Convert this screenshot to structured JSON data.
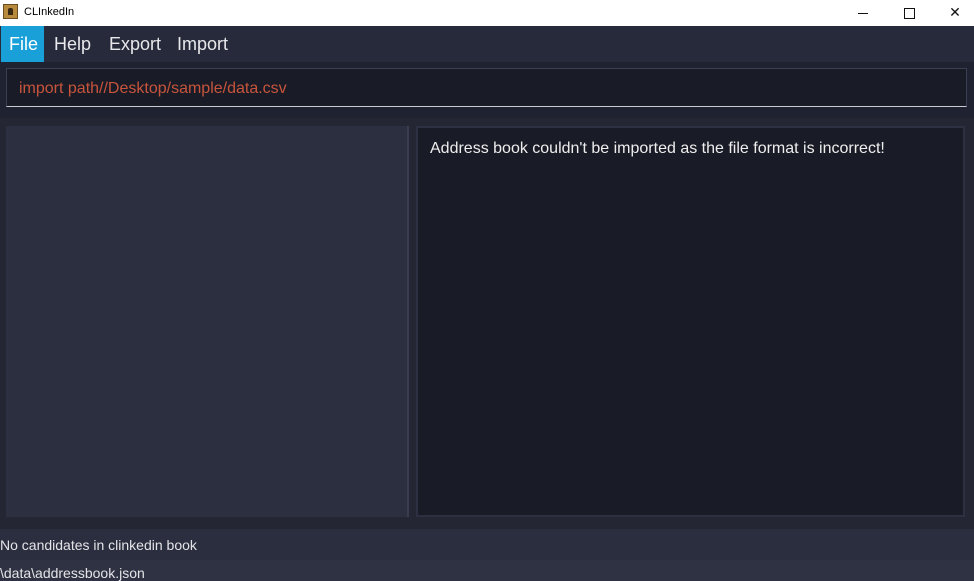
{
  "window": {
    "title": "CLInkedIn",
    "app_icon": "app-book-icon",
    "controls": {
      "minimize_icon": "minimize-icon",
      "maximize_icon": "maximize-icon",
      "close_glyph": "✕"
    }
  },
  "menu": {
    "items": [
      {
        "label": "File",
        "selected": true
      },
      {
        "label": "Help",
        "selected": false
      },
      {
        "label": "Export",
        "selected": false
      },
      {
        "label": "Import",
        "selected": false
      }
    ]
  },
  "command_box": {
    "value": "import path//Desktop/sample/data.csv",
    "text_color": "#c8543c"
  },
  "result_display": {
    "message": "Address book couldn't be imported as the file format is incorrect!"
  },
  "status": {
    "candidates": "No candidates in clinkedin book",
    "file_path": "\\data\\addressbook.json"
  },
  "colors": {
    "accent": "#1aa0d8",
    "background": "#1f2230",
    "panel": "#2c2f40",
    "result_panel": "#191c26",
    "error_text": "#c8543c"
  }
}
